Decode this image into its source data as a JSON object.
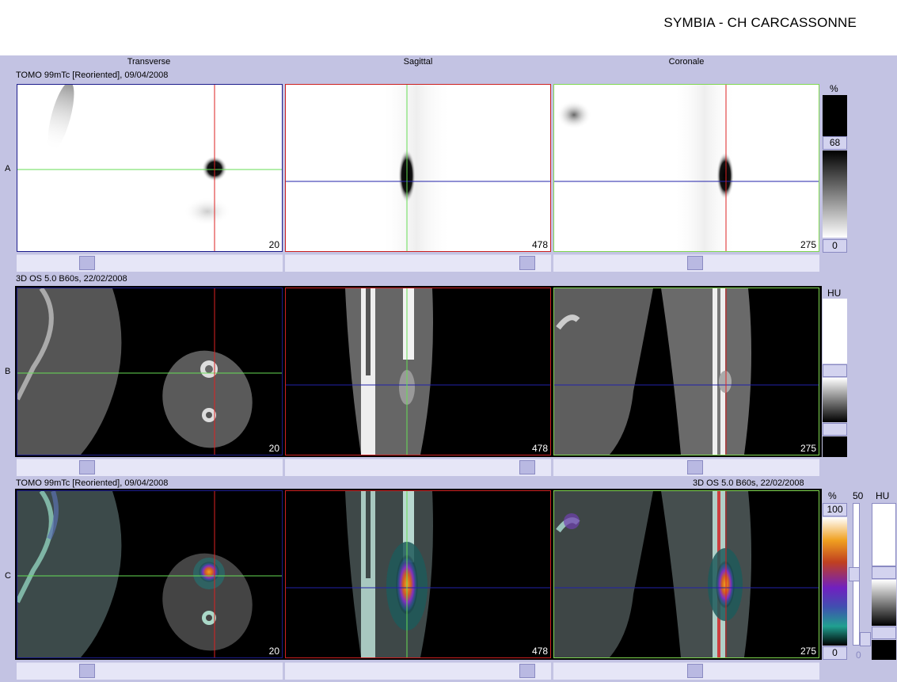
{
  "header": {
    "title": "SYMBIA - CH CARCASSONNE"
  },
  "columns": [
    "Transverse",
    "Sagittal",
    "Coronale"
  ],
  "rows": {
    "a": {
      "letter": "A",
      "caption": "TOMO 99mTc [Reoriented], 09/04/2008"
    },
    "b": {
      "letter": "B",
      "caption": "3D  OS  5.0  B60s, 22/02/2008"
    },
    "c": {
      "letter": "C",
      "caption_left": "TOMO 99mTc [Reoriented], 09/04/2008",
      "caption_right": "3D  OS  5.0  B60s, 22/02/2008"
    }
  },
  "slice_numbers": {
    "transverse": "20",
    "sagittal": "478",
    "coronale": "275"
  },
  "scale_a": {
    "unit": "%",
    "upper": "68",
    "lower": "0"
  },
  "scale_b": {
    "unit": "HU"
  },
  "scale_c": {
    "unit_pct": "%",
    "upper": "100",
    "lower": "0",
    "blend_value": "50",
    "blend_min": "0",
    "unit_hu": "HU"
  },
  "colors": {
    "transverse_frame": "#1c1c8c",
    "sagittal_frame": "#cc2020",
    "coronale_frame": "#80d850",
    "crosshair_green": "#66dd55",
    "crosshair_red": "#dd2222",
    "crosshair_blue": "#2222aa"
  }
}
